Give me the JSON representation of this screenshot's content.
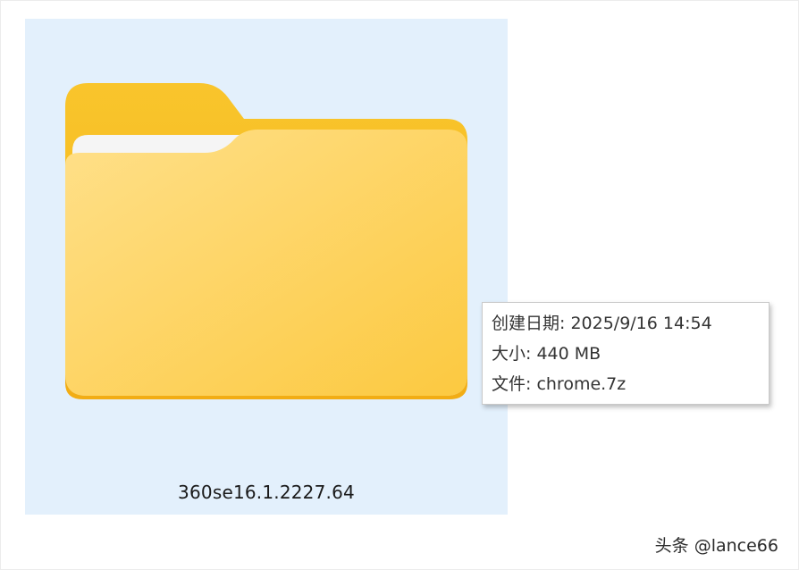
{
  "folder": {
    "name": "360se16.1.2227.64",
    "icon": "folder-icon",
    "tile_color": "#e3f0fc",
    "folder_colors": {
      "back": "#f7bf22",
      "paper": "#f4f4f4",
      "front_top": "#ffe08a",
      "front_bottom": "#fcc940",
      "edge": "#f2ad14"
    }
  },
  "tooltip": {
    "created": "创建日期: 2025/9/16 14:54",
    "size": "大小: 440 MB",
    "files": "文件: chrome.7z"
  },
  "watermark": {
    "text": "头条 @lance66"
  }
}
